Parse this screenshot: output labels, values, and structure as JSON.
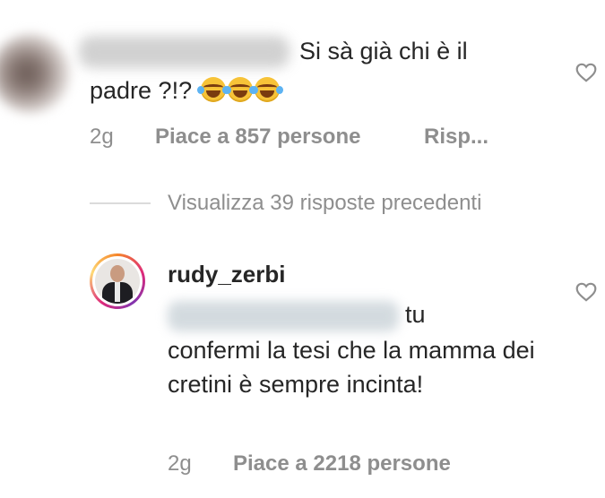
{
  "comment": {
    "text_line1": "Si sà già chi è il",
    "text_line2": "padre ?!?",
    "emojis": [
      "face-with-tears-of-joy",
      "face-with-tears-of-joy",
      "face-with-tears-of-joy"
    ],
    "time": "2g",
    "likes": "Piace a 857 persone",
    "reply_label": "Risp..."
  },
  "view_replies": "Visualizza 39 risposte precedenti",
  "reply": {
    "username": "rudy_zerbi",
    "text_line1": "tu",
    "text_body": "confermi la tesi che la mamma dei cretini è sempre incinta!",
    "time": "2g",
    "likes": "Piace a 2218 persone"
  },
  "icons": {
    "like": "heart-outline-icon"
  },
  "colors": {
    "text": "#262626",
    "muted": "#8e8e8e",
    "divider": "#dbdbdb"
  }
}
